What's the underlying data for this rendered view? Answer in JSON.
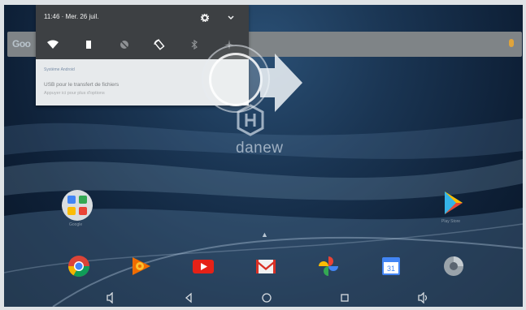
{
  "status": {
    "time_date": "11:46 · Mer. 26 juil."
  },
  "quick_settings": [
    "wifi",
    "battery",
    "do-not-disturb",
    "auto-rotate",
    "bluetooth",
    "airplane"
  ],
  "search": {
    "logo_text": "Goo"
  },
  "notification": {
    "app": "Système Android",
    "title": "USB pour le transfert de fichiers",
    "subtitle": "Appuyer ici pour plus d'options"
  },
  "wallpaper": {
    "brand": "danew"
  },
  "apps": {
    "google_label": "Google",
    "play_label": "Play Store"
  },
  "dock": [
    "chrome",
    "google-play-music",
    "youtube",
    "gmail",
    "photos",
    "calendar",
    "camera"
  ],
  "calendar_day": "31",
  "colors": {
    "shade_bg": "#e7eaec",
    "qs_bg": "#3d4043",
    "screen_bg": "#1a3553"
  }
}
